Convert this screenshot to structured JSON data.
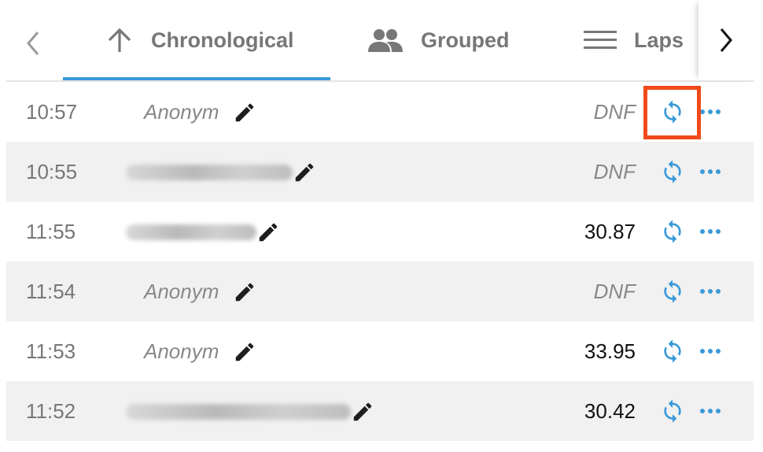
{
  "tabs": [
    {
      "label": "Chronological",
      "icon": "arrow-up-icon",
      "active": true
    },
    {
      "label": "Grouped",
      "icon": "people-icon",
      "active": false
    },
    {
      "label": "Laps",
      "icon": "menu-lines-icon",
      "active": false
    }
  ],
  "colors": {
    "accent": "#3a9ad9",
    "highlight": "#f04a1a",
    "alt_row": "#f1f1f1"
  },
  "rows": [
    {
      "time": "10:57",
      "name": "Anonym",
      "name_obscured": false,
      "result": "DNF",
      "dnf": true,
      "highlighted": true
    },
    {
      "time": "10:55",
      "name": "",
      "name_obscured": true,
      "result": "DNF",
      "dnf": true,
      "highlighted": false
    },
    {
      "time": "11:55",
      "name": "",
      "name_obscured": true,
      "result": "30.87",
      "dnf": false,
      "highlighted": false
    },
    {
      "time": "11:54",
      "name": "Anonym",
      "name_obscured": false,
      "result": "DNF",
      "dnf": true,
      "highlighted": false
    },
    {
      "time": "11:53",
      "name": "Anonym",
      "name_obscured": false,
      "result": "33.95",
      "dnf": false,
      "highlighted": false
    },
    {
      "time": "11:52",
      "name": "",
      "name_obscured": true,
      "result": "30.42",
      "dnf": false,
      "highlighted": false
    }
  ]
}
